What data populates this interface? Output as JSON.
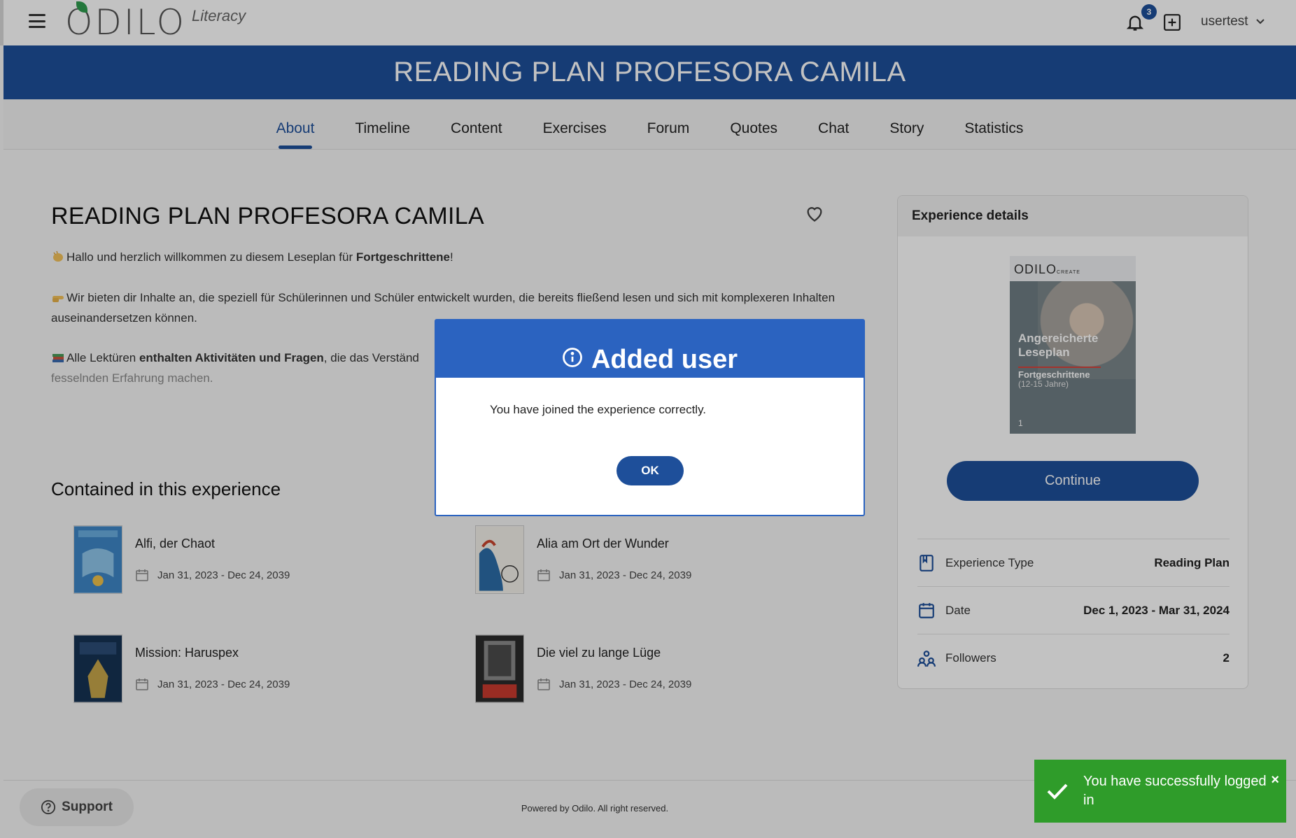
{
  "header": {
    "logo_main": "ODILO",
    "logo_sub": "Literacy",
    "notification_count": "3",
    "username": "usertest"
  },
  "banner": {
    "title": "READING PLAN PROFESORA CAMILA"
  },
  "tabs": [
    {
      "label": "About",
      "active": true
    },
    {
      "label": "Timeline"
    },
    {
      "label": "Content"
    },
    {
      "label": "Exercises"
    },
    {
      "label": "Forum"
    },
    {
      "label": "Quotes"
    },
    {
      "label": "Chat"
    },
    {
      "label": "Story"
    },
    {
      "label": "Statistics"
    }
  ],
  "about": {
    "title": "READING PLAN PROFESORA CAMILA",
    "p1_pre": "Hallo und herzlich willkommen zu diesem Leseplan für ",
    "p1_bold": "Fortgeschrittene",
    "p1_post": "!",
    "p2": "Wir bieten dir Inhalte an, die speziell für Schülerinnen und Schüler entwickelt wurden, die bereits fließend lesen und sich mit komplexeren Inhalten auseinandersetzen können.",
    "p3_pre": "Alle Lektüren ",
    "p3_bold": "enthalten Aktivitäten und Fragen",
    "p3_post": ", die das Verständ",
    "p3_faded": "fesselnden Erfahrung machen."
  },
  "contained": {
    "title": "Contained in this experience",
    "items": [
      {
        "title": "Alfi, der Chaot",
        "date": "Jan 31, 2023 - Dec 24, 2039"
      },
      {
        "title": "Alia am Ort der Wunder",
        "date": "Jan 31, 2023 - Dec 24, 2039"
      },
      {
        "title": "Mission: Haruspex",
        "date": "Jan 31, 2023 - Dec 24, 2039"
      },
      {
        "title": "Die viel zu lange Lüge",
        "date": "Jan 31, 2023 - Dec 24, 2039"
      }
    ]
  },
  "details": {
    "title": "Experience details",
    "cover_brand": "ODILO",
    "cover_brand_small": "CREATE",
    "cover_title": "Angereicherte Leseplan",
    "cover_subtitle": "Fortgeschrittene",
    "cover_age": "(12-15 Jahre)",
    "cover_number": "1",
    "continue_label": "Continue",
    "rows": [
      {
        "label": "Experience Type",
        "value": "Reading Plan"
      },
      {
        "label": "Date",
        "value": "Dec 1, 2023 - Mar 31, 2024"
      },
      {
        "label": "Followers",
        "value": "2"
      }
    ]
  },
  "footer": {
    "support_label": "Support",
    "powered": "Powered by Odilo. All right reserved."
  },
  "modal": {
    "title": "Added user",
    "message": "You have joined the experience correctly.",
    "ok_label": "OK"
  },
  "toast": {
    "message": "You have successfully logged in",
    "close": "×"
  },
  "colors": {
    "brand_blue": "#1e4f9a",
    "modal_blue": "#2b63c0",
    "toast_green": "#2f9c2a",
    "logo_green": "#2e9b4e"
  }
}
